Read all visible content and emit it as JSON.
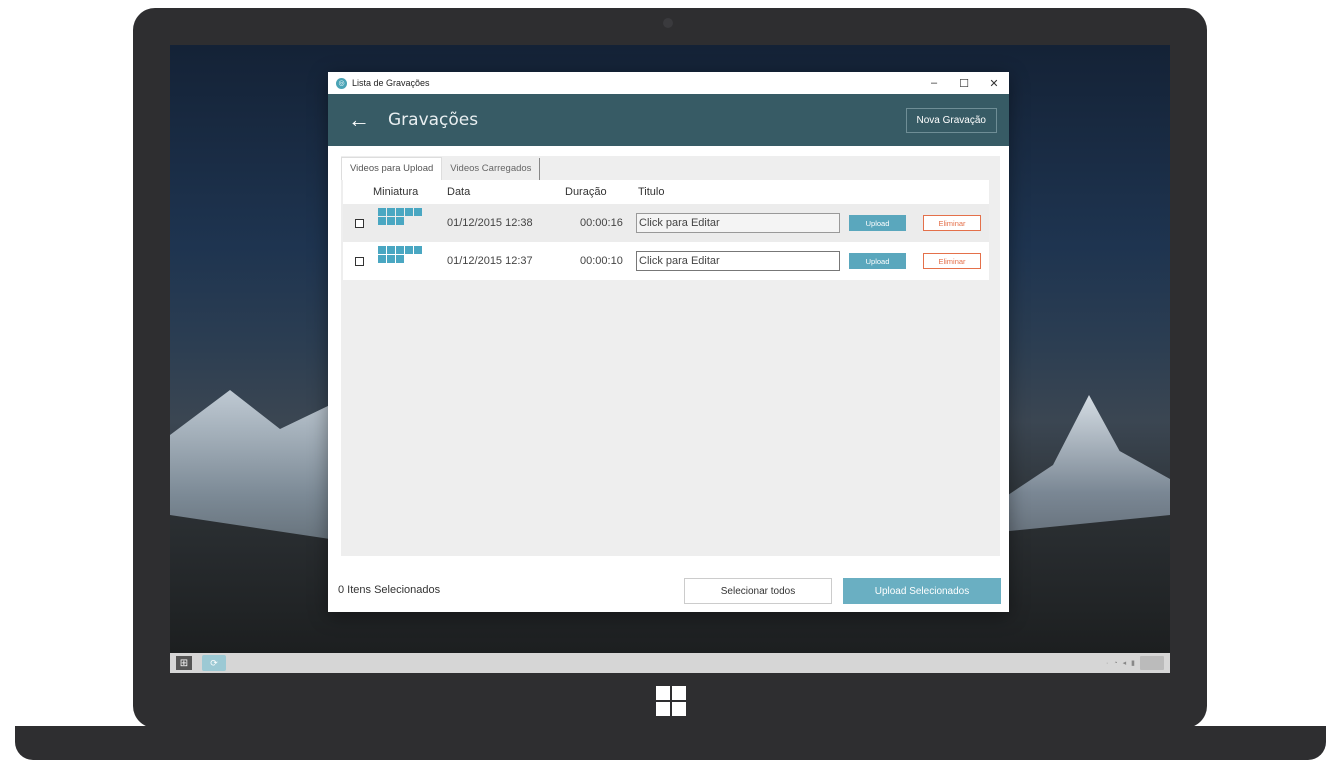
{
  "window": {
    "title": "Lista de Gravações",
    "controls": {
      "minimize": "–",
      "maximize": "☐",
      "close": "✕"
    }
  },
  "header": {
    "back_icon": "←",
    "title": "Gravações",
    "new_button": "Nova Gravação"
  },
  "tabs": [
    {
      "label": "Videos para Upload",
      "active": true
    },
    {
      "label": "Videos Carregados",
      "active": false
    }
  ],
  "columns": {
    "thumbnail": "Miniatura",
    "date": "Data",
    "duration": "Duração",
    "title": "Titulo"
  },
  "rows": [
    {
      "date": "01/12/2015 12:38",
      "duration": "00:00:16",
      "title_value": "Click para Editar",
      "upload_label": "Upload",
      "delete_label": "Eliminar"
    },
    {
      "date": "01/12/2015 12:37",
      "duration": "00:00:10",
      "title_value": "Click para Editar",
      "upload_label": "Upload",
      "delete_label": "Eliminar"
    }
  ],
  "footer": {
    "selected_count": "0 Itens Selecionados",
    "select_all": "Selecionar todos",
    "upload_selected": "Upload Selecionados"
  },
  "colors": {
    "header_bg": "#375b65",
    "accent": "#5aa7bd",
    "danger": "#e4704a"
  }
}
